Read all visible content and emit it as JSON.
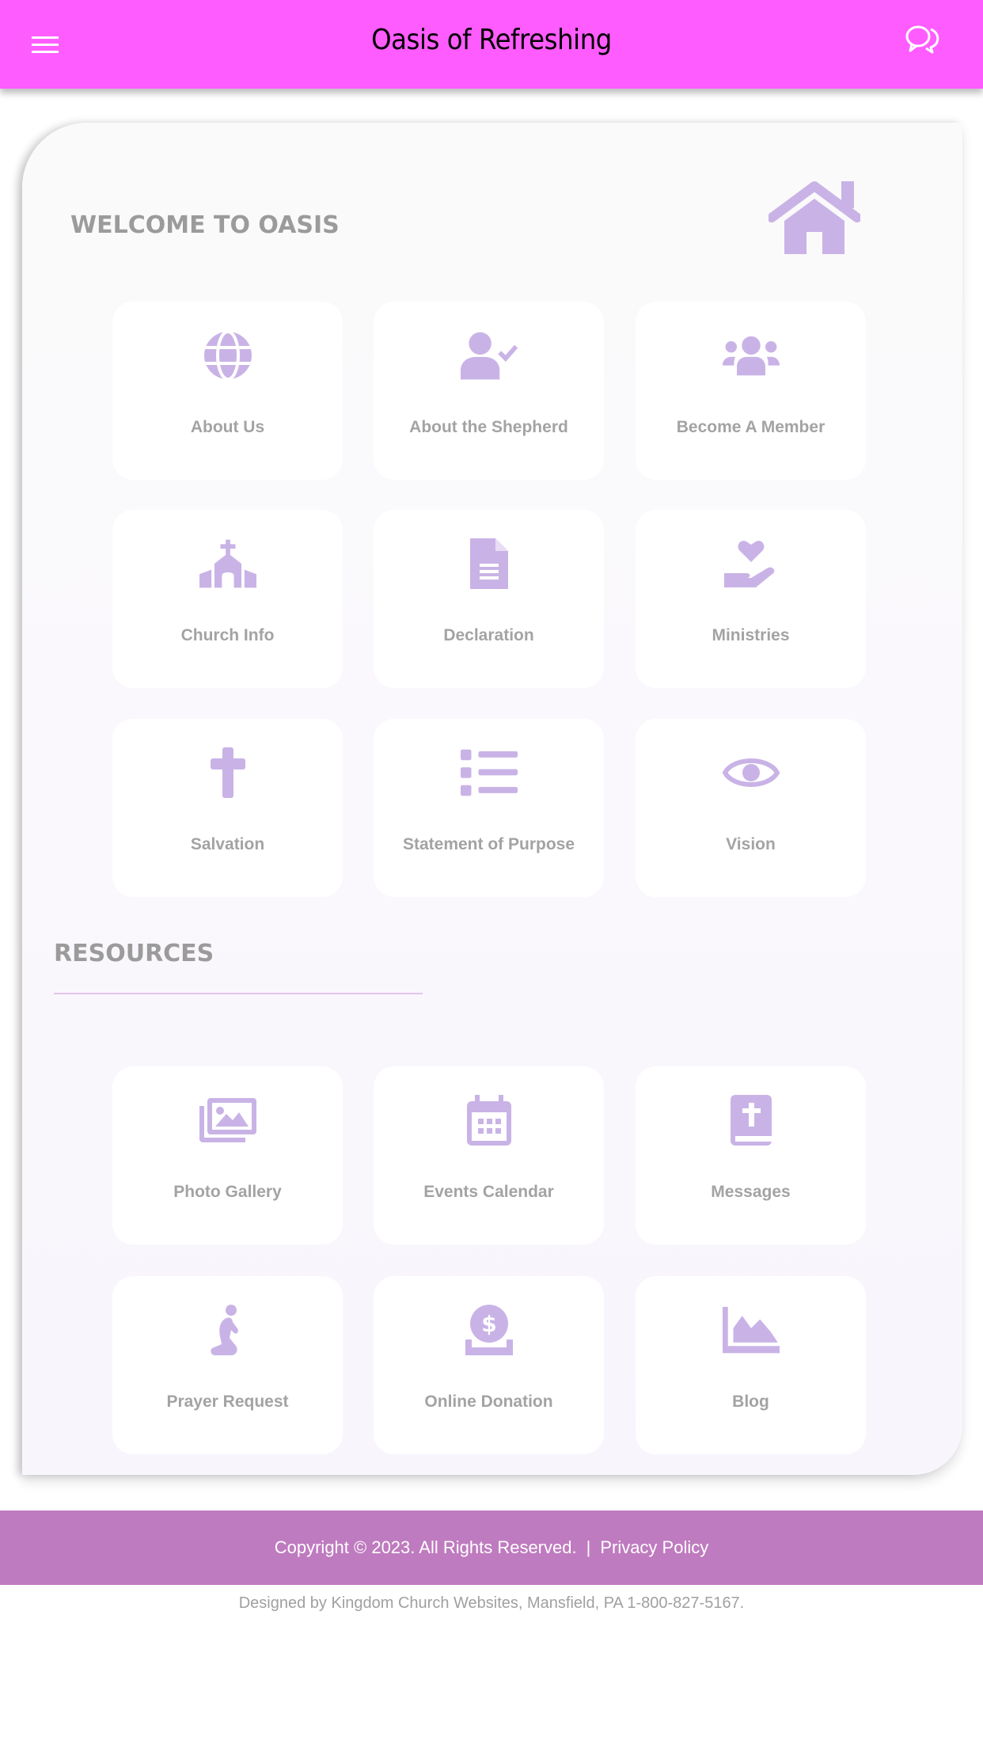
{
  "header": {
    "title": "Oasis of Refreshing",
    "menu_icon": "hamburger-menu-icon",
    "chat_icon": "chat-bubbles-icon",
    "background_color": "#ff5cff"
  },
  "welcome": {
    "title": "WELCOME TO OASIS",
    "icon": "home-icon",
    "tiles": [
      {
        "label": "About Us",
        "icon": "globe-icon"
      },
      {
        "label": "About the Shepherd",
        "icon": "user-check-icon"
      },
      {
        "label": "Become A Member",
        "icon": "users-group-icon"
      },
      {
        "label": "Church Info",
        "icon": "church-icon"
      },
      {
        "label": "Declaration",
        "icon": "document-icon"
      },
      {
        "label": "Ministries",
        "icon": "hand-holding-heart-icon"
      },
      {
        "label": "Salvation",
        "icon": "cross-icon"
      },
      {
        "label": "Statement of Purpose",
        "icon": "list-icon"
      },
      {
        "label": "Vision",
        "icon": "eye-icon"
      }
    ]
  },
  "resources": {
    "title": "RESOURCES",
    "tiles": [
      {
        "label": "Photo Gallery",
        "icon": "photo-gallery-icon"
      },
      {
        "label": "Events Calendar",
        "icon": "calendar-icon"
      },
      {
        "label": "Messages",
        "icon": "bible-icon"
      },
      {
        "label": "Prayer Request",
        "icon": "praying-person-icon"
      },
      {
        "label": "Online Donation",
        "icon": "donate-icon"
      },
      {
        "label": "Blog",
        "icon": "area-chart-icon"
      }
    ]
  },
  "footer": {
    "copyright": "Copyright © 2023. All Rights Reserved.",
    "separator": "|",
    "privacy_link": "Privacy Policy",
    "designed_by": "Designed by Kingdom Church Websites, Mansfield, PA 1-800-827-5167.",
    "band_color": "#bf7bbf"
  },
  "colors": {
    "icon": "#c9b3e6",
    "label": "#a3a3a3",
    "section_title": "#9b9b9b",
    "divider": "#e5c3ee"
  }
}
